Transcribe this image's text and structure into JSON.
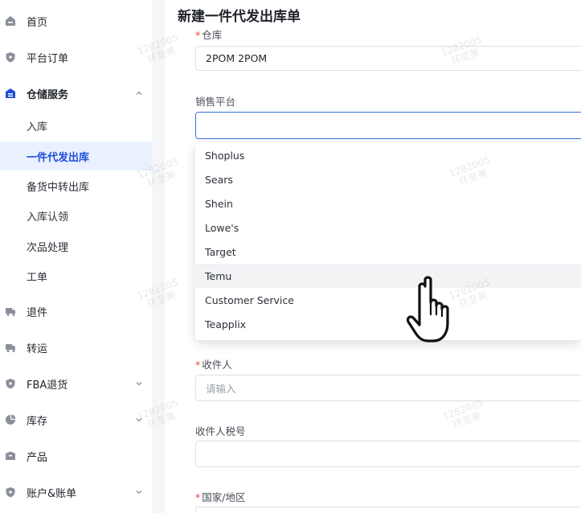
{
  "sidebar": {
    "items": [
      {
        "label": "首页",
        "icon": "home-icon"
      },
      {
        "label": "平台订单",
        "icon": "shield-icon"
      },
      {
        "label": "仓储服务",
        "icon": "warehouse-icon"
      },
      {
        "label": "退件",
        "icon": "truck-icon"
      },
      {
        "label": "转运",
        "icon": "truck-icon"
      },
      {
        "label": "FBA退货",
        "icon": "shield-icon"
      },
      {
        "label": "库存",
        "icon": "pie-chart-icon"
      },
      {
        "label": "产品",
        "icon": "box-icon"
      },
      {
        "label": "账户&账单",
        "icon": "shield-icon"
      }
    ],
    "sub_items": [
      {
        "label": "入库"
      },
      {
        "label": "一件代发出库"
      },
      {
        "label": "备货中转出库"
      },
      {
        "label": "入库认领"
      },
      {
        "label": "次品处理"
      },
      {
        "label": "工单"
      }
    ]
  },
  "page": {
    "title": "新建一件代发出库单"
  },
  "form": {
    "warehouse_label": "仓库",
    "warehouse_value": "2POM 2POM",
    "platform_label": "销售平台",
    "platform_value": "",
    "recipient_label": "收件人",
    "recipient_placeholder": "请输入",
    "tax_label": "收件人税号",
    "tax_value": "",
    "country_label": "国家/地区",
    "required_mark": "*"
  },
  "dropdown": {
    "options": [
      "Shoplus",
      "Sears",
      "Shein",
      "Lowe's",
      "Target",
      "Temu",
      "Customer Service",
      "Teapplix"
    ],
    "hovered": "Temu"
  },
  "watermark": {
    "line1": "1282005",
    "line2": "环至美"
  },
  "colors": {
    "accent": "#1d4ed8",
    "active_bg": "#eaf0fe",
    "required": "#f04438",
    "icon": "#8a8f99"
  }
}
